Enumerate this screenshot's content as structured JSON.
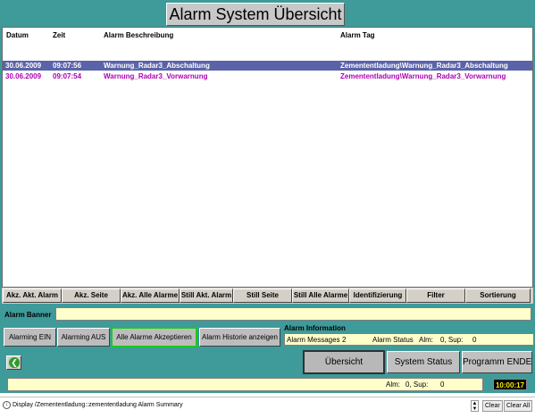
{
  "window": {
    "title": "Alarm System Übersicht"
  },
  "grid": {
    "headers": {
      "date": "Datum",
      "time": "Zeit",
      "description": "Alarm Beschreibung",
      "tag": "Alarm Tag"
    },
    "rows": [
      {
        "date": "30.06.2009",
        "time": "09:07:56",
        "description": "Warnung_Radar3_Abschaltung",
        "tag": "Zemententladung\\Warnung_Radar3_Abschaltung",
        "selected": true
      },
      {
        "date": "30.06.2009",
        "time": "09:07:54",
        "description": "Warnung_Radar3_Vorwarnung",
        "tag": "Zemententladung\\Warnung_Radar3_Vorwarnung",
        "selected": false
      }
    ]
  },
  "column_buttons": [
    "Akz. Akt. Alarm",
    "Akz. Seite",
    "Akz. Alle Alarme",
    "Still Akt. Alarm",
    "Still Seite",
    "Still Alle Alarme",
    "Identifizierung",
    "Filter",
    "Sortierung"
  ],
  "banner": {
    "label": "Alarm Banner",
    "value": ""
  },
  "actions": {
    "alarming_on": "Alarming EIN",
    "alarming_off": "Alarming AUS",
    "ack_all": "Alle Alarme Akzeptieren",
    "history": "Alarm Historie anzeigen"
  },
  "info": {
    "title": "Alarm Information",
    "messages": "Alarm Messages",
    "messages_count": "2",
    "status_label": "Alarm Status",
    "alm": "Alm:",
    "alm_value": "0, Sup:",
    "sup_value": "0"
  },
  "nav": {
    "overview": "Übersicht",
    "system_status": "System Status",
    "program_end": "Programm ENDE"
  },
  "status": {
    "alm": "Alm:",
    "alm_value": "0, Sup:",
    "sup_value": "0",
    "clock": "10:00:17"
  },
  "statusbar": {
    "path": "Display /Zemententladung::zemententladung Alarm Summary",
    "clear": "Clear",
    "clear_all": "Clear All"
  },
  "colors": {
    "frame": "#3f9a9a",
    "selected_row": "#5a63a8",
    "warning_text": "#b000b0",
    "field": "#ffffcc",
    "clock_text": "#ffee00"
  },
  "icons": {
    "back": "back-arrow-icon",
    "download": "download-icon"
  }
}
